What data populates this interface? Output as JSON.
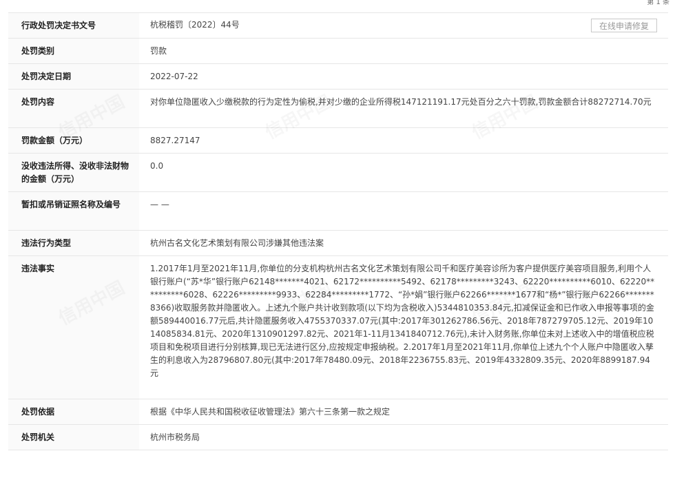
{
  "page_indicator": "第 1 条",
  "records": [
    {
      "label": "行政处罚决定书文号",
      "value": "杭税稽罚〔2022〕44号",
      "button": "在线申请修复"
    },
    {
      "label": "处罚类别",
      "value": "罚款"
    },
    {
      "label": "处罚决定日期",
      "value": "2022-07-22"
    },
    {
      "label": "处罚内容",
      "value": "对你单位隐匿收入少缴税款的行为定性为偷税,并对少缴的企业所得税147121191.17元处百分之六十罚款,罚款金额合计88272714.70元"
    },
    {
      "label": "罚款金额（万元）",
      "value": "8827.27147"
    },
    {
      "label": "没收违法所得、没收非法财物的金额（万元）",
      "value": "0.0"
    },
    {
      "label": "暂扣或吊销证照名称及编号",
      "value": "— —"
    },
    {
      "label": "违法行为类型",
      "value": "杭州古名文化艺术策划有限公司涉嫌其他违法案"
    },
    {
      "label": "违法事实",
      "value": "1.2017年1月至2021年11月,你单位的分支机构杭州古名文化艺术策划有限公司千和医疗美容诊所为客户提供医疗美容项目服务,利用个人银行账户(“苏*华”银行账户62148*******4021、62172**********5492、62178*********3243、62220**********6010、62220**********6028、62226*********9933、62284*********1772、“孙*娟”银行账户62266*******1677和“杨*”银行账户62266*******8366)收取服务款并隐匿收入。上述九个账户共计收到款项(以下均为含税收入)5344810353.84元,扣减保证金和已作收入申报等事项的金额589440016.77元后,共计隐匿服务收入4755370337.07元(其中:2017年301262786.56元、2018年787279705.12元、2019年1014085834.81元、2020年1310901297.82元、2021年1-11月1341840712.76元),未计入财务账,你单位未对上述收入中的增值税应税项目和免税项目进行分别核算,现已无法进行区分,应按规定申报纳税。2.2017年1月至2021年11月,你单位上述九个个人账户中隐匿收入孳生的利息收入为28796807.80元(其中:2017年78480.09元、2018年2236755.83元、2019年4332809.35元、2020年8899187.94元"
    },
    {
      "label": "处罚依据",
      "value": "根据《中华人民共和国税收征收管理法》第六十三条第一款之规定"
    },
    {
      "label": "处罚机关",
      "value": "杭州市税务局"
    }
  ],
  "watermark_text": "信用中国"
}
